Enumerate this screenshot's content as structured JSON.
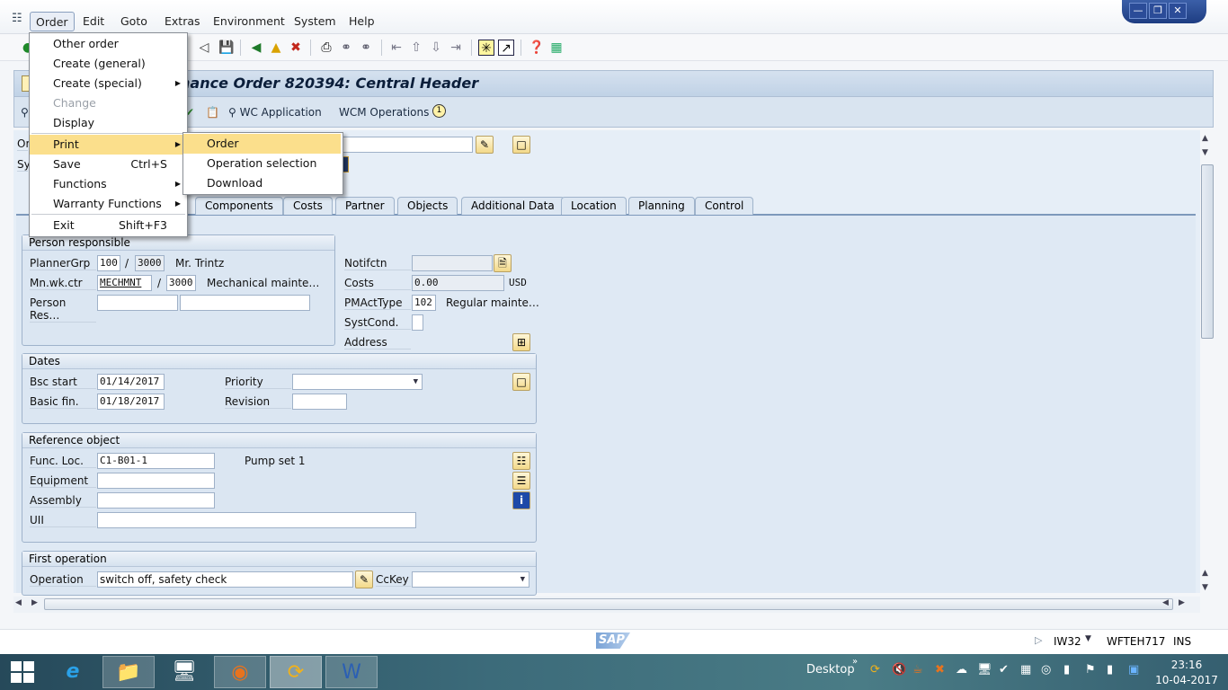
{
  "window": {
    "controls": [
      "minimize",
      "restore",
      "close"
    ]
  },
  "menubar": {
    "items": [
      "Order",
      "Edit",
      "Goto",
      "Extras",
      "Environment",
      "System",
      "Help"
    ],
    "active": "Order"
  },
  "title": "Display Maintenance Order 820394: Central Header",
  "title_visible": "nance Order 820394: Central Header",
  "app_toolbar": {
    "wc_application": "WC Application",
    "wcm_operations": "WCM Operations",
    "badge": "1"
  },
  "order_menu": {
    "items": [
      {
        "label": "Other order",
        "shortcut": "",
        "submenu": false,
        "disabled": false
      },
      {
        "label": "Create (general)",
        "shortcut": "",
        "submenu": false,
        "disabled": false
      },
      {
        "label": "Create (special)",
        "shortcut": "",
        "submenu": true,
        "disabled": false
      },
      {
        "label": "Change",
        "shortcut": "",
        "submenu": false,
        "disabled": true
      },
      {
        "label": "Display",
        "shortcut": "",
        "submenu": false,
        "disabled": false
      },
      {
        "label": "Print",
        "shortcut": "",
        "submenu": true,
        "disabled": false,
        "highlighted": true
      },
      {
        "label": "Save",
        "shortcut": "Ctrl+S",
        "submenu": false,
        "disabled": false
      },
      {
        "label": "Functions",
        "shortcut": "",
        "submenu": true,
        "disabled": false
      },
      {
        "label": "Warranty Functions",
        "shortcut": "",
        "submenu": true,
        "disabled": false
      },
      {
        "label": "Exit",
        "shortcut": "Shift+F3",
        "submenu": false,
        "disabled": false
      }
    ]
  },
  "print_menu": {
    "items": [
      "Order",
      "Operation selection",
      "Download"
    ],
    "highlighted": "Order"
  },
  "header_fields": {
    "order_label": "Or",
    "sys_status_label": "Sy"
  },
  "tabs": [
    "Components",
    "Costs",
    "Partner",
    "Objects",
    "Additional Data",
    "Location",
    "Planning",
    "Control"
  ],
  "person_responsible": {
    "title": "Person responsible",
    "planner_grp_label": "PlannerGrp",
    "planner_grp": "100",
    "planner_plant": "3000",
    "planner_name": "Mr. Trintz",
    "work_ctr_label": "Mn.wk.ctr",
    "work_ctr": "MECHMNT",
    "work_ctr_plant": "3000",
    "work_ctr_name": "Mechanical mainte…",
    "person_res_label": "Person Res…",
    "person_res": "",
    "person_res_name": ""
  },
  "notification": {
    "notifctn_label": "Notifctn",
    "notifctn": "",
    "costs_label": "Costs",
    "costs": "0.00",
    "currency": "USD",
    "pmacttype_label": "PMActType",
    "pmacttype": "102",
    "pmacttype_name": "Regular mainte…",
    "systcond_label": "SystCond.",
    "systcond": "",
    "address_label": "Address"
  },
  "dates": {
    "title": "Dates",
    "bsc_start_label": "Bsc start",
    "bsc_start": "01/14/2017",
    "basic_fin_label": "Basic fin.",
    "basic_fin": "01/18/2017",
    "priority_label": "Priority",
    "priority": "",
    "revision_label": "Revision",
    "revision": ""
  },
  "reference_object": {
    "title": "Reference object",
    "func_loc_label": "Func. Loc.",
    "func_loc": "C1-B01-1",
    "func_loc_desc": "Pump set 1",
    "equipment_label": "Equipment",
    "equipment": "",
    "assembly_label": "Assembly",
    "assembly": "",
    "uii_label": "UII",
    "uii": ""
  },
  "first_operation": {
    "title": "First operation",
    "operation_label": "Operation",
    "operation": "switch off, safety check",
    "cckey_label": "CcKey",
    "cckey": ""
  },
  "statusbar": {
    "transaction": "IW32",
    "server": "WFTEH717",
    "mode": "INS",
    "logo": "SAP"
  },
  "taskbar": {
    "desktop_label": "Desktop",
    "time": "23:16",
    "date": "10-04-2017"
  }
}
